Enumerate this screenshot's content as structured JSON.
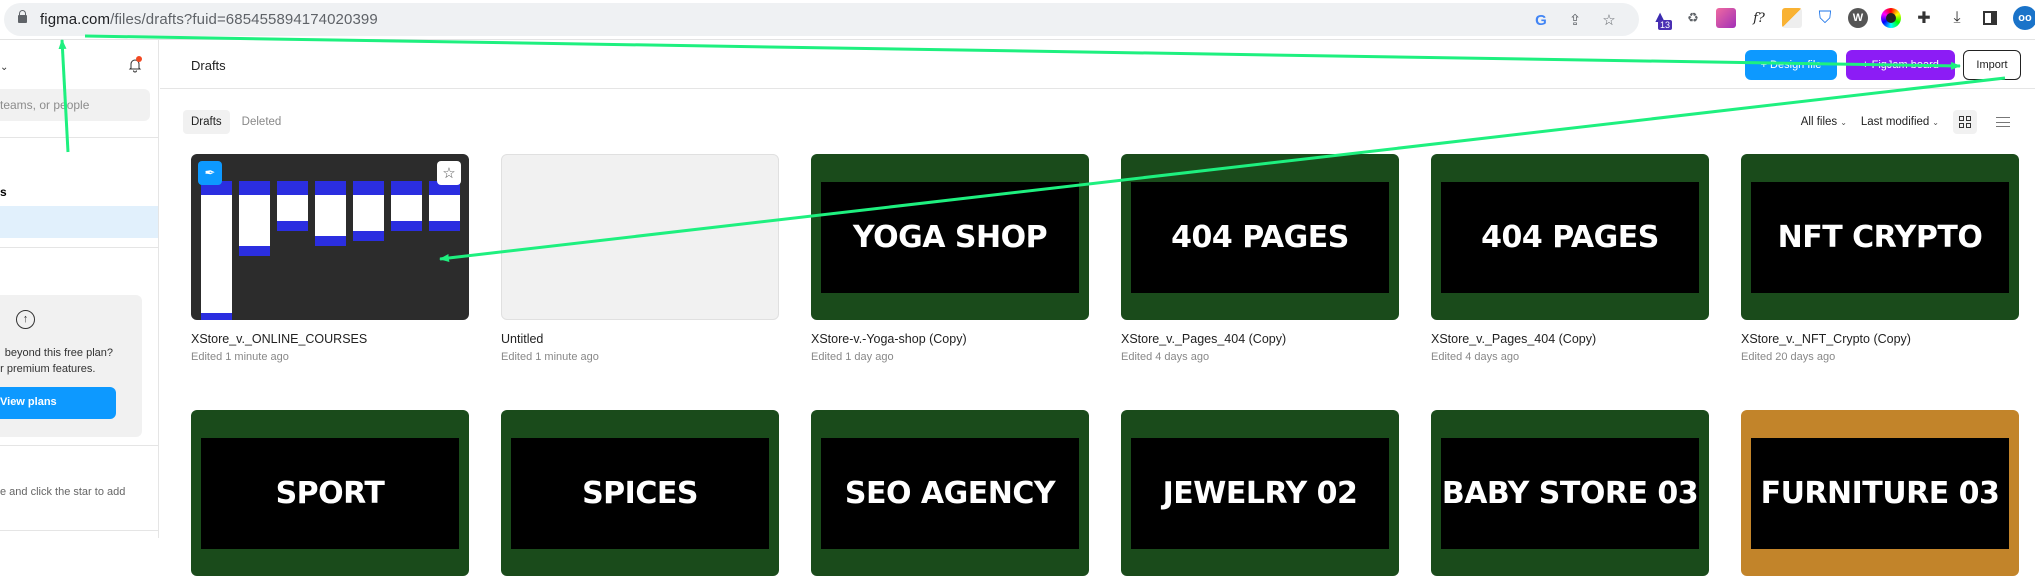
{
  "browser": {
    "url_host": "figma.com",
    "url_path": "/files/drafts?fuid=685455894174020399",
    "extension_badge": "13",
    "avatar_label": "oo"
  },
  "sidebar": {
    "search_placeholder": "Search files, teams, or people",
    "search_visible_text": "teams, or people",
    "section_title_partial": "s",
    "upgrade_line1": "beyond this free plan?",
    "upgrade_line2": "or premium features.",
    "view_plans_label": "View plans",
    "favorites_hint": "e and click the star to add"
  },
  "header": {
    "title": "Drafts",
    "design_file_label": "+ Design file",
    "figjam_board_label": "+ FigJam board",
    "import_label": "Import"
  },
  "toolbar": {
    "tabs": [
      {
        "label": "Drafts",
        "active": true
      },
      {
        "label": "Deleted",
        "active": false
      }
    ],
    "filter_label": "All files",
    "sort_label": "Last modified"
  },
  "files": [
    {
      "name": "XStore_v._ONLINE_COURSES",
      "edited": "Edited 1 minute ago",
      "thumb": "frames",
      "banner": ""
    },
    {
      "name": "Untitled",
      "edited": "Edited 1 minute ago",
      "thumb": "empty",
      "banner": ""
    },
    {
      "name": "XStore-v.-Yoga-shop (Copy)",
      "edited": "Edited 1 day ago",
      "thumb": "green",
      "banner": "YOGA SHOP"
    },
    {
      "name": "XStore_v._Pages_404 (Copy)",
      "edited": "Edited 4 days ago",
      "thumb": "green",
      "banner": "404 PAGES"
    },
    {
      "name": "XStore_v._Pages_404 (Copy)",
      "edited": "Edited 4 days ago",
      "thumb": "green",
      "banner": "404 PAGES"
    },
    {
      "name": "XStore_v._NFT_Crypto (Copy)",
      "edited": "Edited 20 days ago",
      "thumb": "green",
      "banner": "NFT CRYPTO"
    },
    {
      "name": "",
      "edited": "",
      "thumb": "green",
      "banner": "SPORT"
    },
    {
      "name": "",
      "edited": "",
      "thumb": "green",
      "banner": "SPICES"
    },
    {
      "name": "",
      "edited": "",
      "thumb": "green",
      "banner": "SEO AGENCY"
    },
    {
      "name": "",
      "edited": "",
      "thumb": "green",
      "banner": "JEWELRY 02"
    },
    {
      "name": "",
      "edited": "",
      "thumb": "green",
      "banner": "BABY STORE 03"
    },
    {
      "name": "",
      "edited": "",
      "thumb": "orange",
      "banner": "FURNITURE 03"
    }
  ],
  "colors": {
    "figma_blue": "#0d99ff",
    "figjam_purple": "#8c1cf5",
    "thumb_green": "#1a4b1b",
    "thumb_orange": "#c2842a",
    "annotation_green": "#1ef07f",
    "notification_red": "#f24822"
  }
}
